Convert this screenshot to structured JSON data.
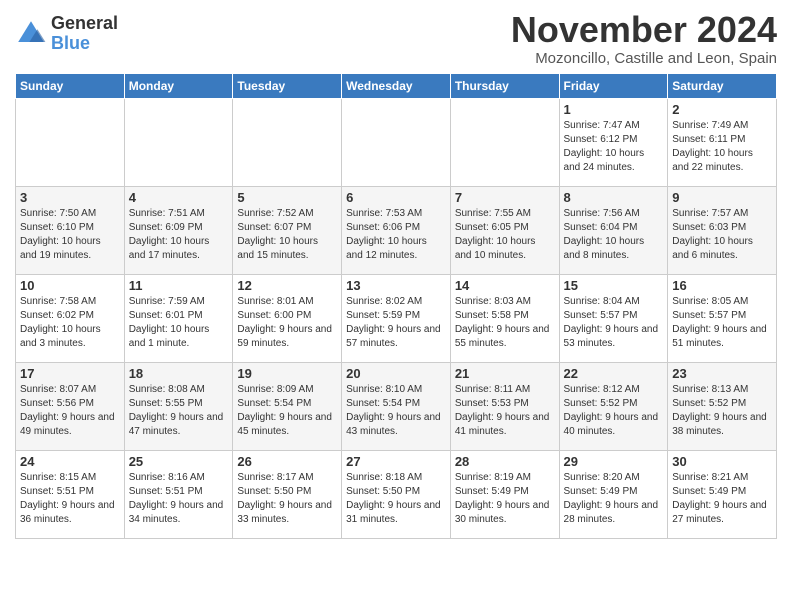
{
  "logo": {
    "general": "General",
    "blue": "Blue"
  },
  "title": "November 2024",
  "location": "Mozoncillo, Castille and Leon, Spain",
  "days_header": [
    "Sunday",
    "Monday",
    "Tuesday",
    "Wednesday",
    "Thursday",
    "Friday",
    "Saturday"
  ],
  "weeks": [
    [
      {
        "day": "",
        "content": ""
      },
      {
        "day": "",
        "content": ""
      },
      {
        "day": "",
        "content": ""
      },
      {
        "day": "",
        "content": ""
      },
      {
        "day": "",
        "content": ""
      },
      {
        "day": "1",
        "content": "Sunrise: 7:47 AM\nSunset: 6:12 PM\nDaylight: 10 hours and 24 minutes."
      },
      {
        "day": "2",
        "content": "Sunrise: 7:49 AM\nSunset: 6:11 PM\nDaylight: 10 hours and 22 minutes."
      }
    ],
    [
      {
        "day": "3",
        "content": "Sunrise: 7:50 AM\nSunset: 6:10 PM\nDaylight: 10 hours and 19 minutes."
      },
      {
        "day": "4",
        "content": "Sunrise: 7:51 AM\nSunset: 6:09 PM\nDaylight: 10 hours and 17 minutes."
      },
      {
        "day": "5",
        "content": "Sunrise: 7:52 AM\nSunset: 6:07 PM\nDaylight: 10 hours and 15 minutes."
      },
      {
        "day": "6",
        "content": "Sunrise: 7:53 AM\nSunset: 6:06 PM\nDaylight: 10 hours and 12 minutes."
      },
      {
        "day": "7",
        "content": "Sunrise: 7:55 AM\nSunset: 6:05 PM\nDaylight: 10 hours and 10 minutes."
      },
      {
        "day": "8",
        "content": "Sunrise: 7:56 AM\nSunset: 6:04 PM\nDaylight: 10 hours and 8 minutes."
      },
      {
        "day": "9",
        "content": "Sunrise: 7:57 AM\nSunset: 6:03 PM\nDaylight: 10 hours and 6 minutes."
      }
    ],
    [
      {
        "day": "10",
        "content": "Sunrise: 7:58 AM\nSunset: 6:02 PM\nDaylight: 10 hours and 3 minutes."
      },
      {
        "day": "11",
        "content": "Sunrise: 7:59 AM\nSunset: 6:01 PM\nDaylight: 10 hours and 1 minute."
      },
      {
        "day": "12",
        "content": "Sunrise: 8:01 AM\nSunset: 6:00 PM\nDaylight: 9 hours and 59 minutes."
      },
      {
        "day": "13",
        "content": "Sunrise: 8:02 AM\nSunset: 5:59 PM\nDaylight: 9 hours and 57 minutes."
      },
      {
        "day": "14",
        "content": "Sunrise: 8:03 AM\nSunset: 5:58 PM\nDaylight: 9 hours and 55 minutes."
      },
      {
        "day": "15",
        "content": "Sunrise: 8:04 AM\nSunset: 5:57 PM\nDaylight: 9 hours and 53 minutes."
      },
      {
        "day": "16",
        "content": "Sunrise: 8:05 AM\nSunset: 5:57 PM\nDaylight: 9 hours and 51 minutes."
      }
    ],
    [
      {
        "day": "17",
        "content": "Sunrise: 8:07 AM\nSunset: 5:56 PM\nDaylight: 9 hours and 49 minutes."
      },
      {
        "day": "18",
        "content": "Sunrise: 8:08 AM\nSunset: 5:55 PM\nDaylight: 9 hours and 47 minutes."
      },
      {
        "day": "19",
        "content": "Sunrise: 8:09 AM\nSunset: 5:54 PM\nDaylight: 9 hours and 45 minutes."
      },
      {
        "day": "20",
        "content": "Sunrise: 8:10 AM\nSunset: 5:54 PM\nDaylight: 9 hours and 43 minutes."
      },
      {
        "day": "21",
        "content": "Sunrise: 8:11 AM\nSunset: 5:53 PM\nDaylight: 9 hours and 41 minutes."
      },
      {
        "day": "22",
        "content": "Sunrise: 8:12 AM\nSunset: 5:52 PM\nDaylight: 9 hours and 40 minutes."
      },
      {
        "day": "23",
        "content": "Sunrise: 8:13 AM\nSunset: 5:52 PM\nDaylight: 9 hours and 38 minutes."
      }
    ],
    [
      {
        "day": "24",
        "content": "Sunrise: 8:15 AM\nSunset: 5:51 PM\nDaylight: 9 hours and 36 minutes."
      },
      {
        "day": "25",
        "content": "Sunrise: 8:16 AM\nSunset: 5:51 PM\nDaylight: 9 hours and 34 minutes."
      },
      {
        "day": "26",
        "content": "Sunrise: 8:17 AM\nSunset: 5:50 PM\nDaylight: 9 hours and 33 minutes."
      },
      {
        "day": "27",
        "content": "Sunrise: 8:18 AM\nSunset: 5:50 PM\nDaylight: 9 hours and 31 minutes."
      },
      {
        "day": "28",
        "content": "Sunrise: 8:19 AM\nSunset: 5:49 PM\nDaylight: 9 hours and 30 minutes."
      },
      {
        "day": "29",
        "content": "Sunrise: 8:20 AM\nSunset: 5:49 PM\nDaylight: 9 hours and 28 minutes."
      },
      {
        "day": "30",
        "content": "Sunrise: 8:21 AM\nSunset: 5:49 PM\nDaylight: 9 hours and 27 minutes."
      }
    ]
  ]
}
